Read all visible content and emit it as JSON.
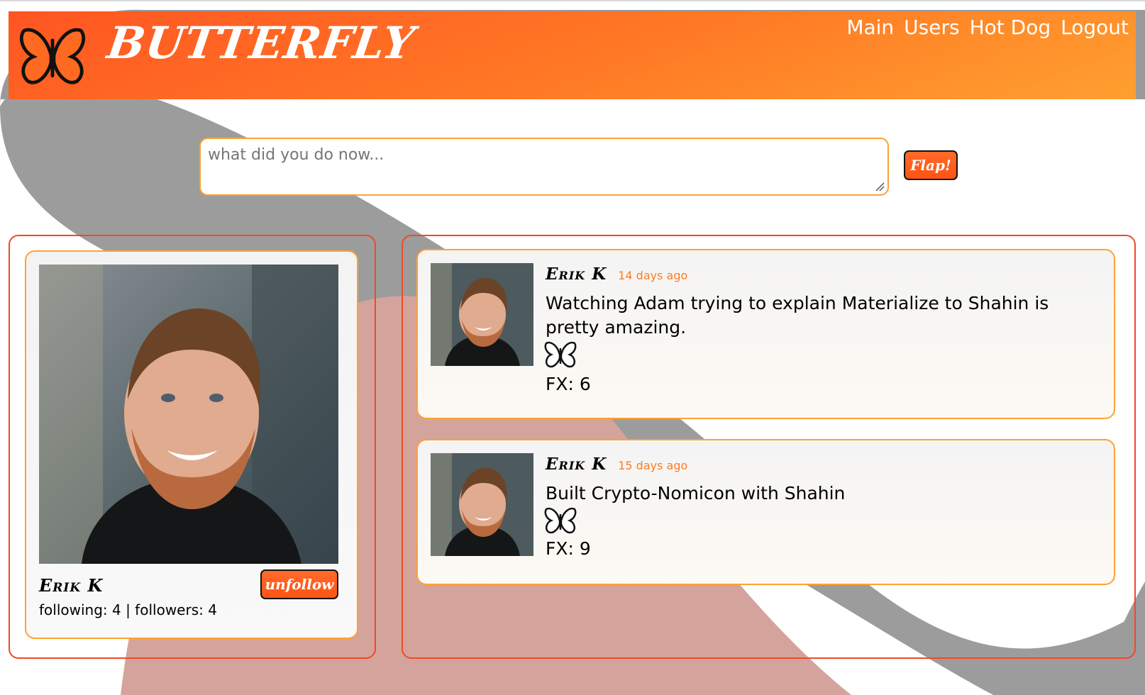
{
  "header": {
    "brand": "BUTTERFLY",
    "nav": [
      "Main",
      "Users",
      "Hot Dog",
      "Logout"
    ]
  },
  "compose": {
    "placeholder": "what did you do now...",
    "submit_label": "Flap!"
  },
  "profile": {
    "name": "Erik K",
    "unfollow_label": "unfollow",
    "stats": "following: 4 | followers: 4"
  },
  "posts": [
    {
      "author": "Erik K",
      "time": "14 days ago",
      "text": "Watching Adam trying to explain Materialize to Shahin is pretty amazing.",
      "fx": "FX: 6"
    },
    {
      "author": "Erik K",
      "time": "15 days ago",
      "text": "Built Crypto-Nomicon with Shahin",
      "fx": "FX: 9"
    }
  ],
  "colors": {
    "accent": "#ff5a1f",
    "accent_light": "#ffa133",
    "panel_border": "#ee4a28",
    "time_text": "#ff7a22"
  },
  "icons": {
    "logo": "butterfly-logo-icon",
    "flutter": "butterfly-outline-icon"
  }
}
